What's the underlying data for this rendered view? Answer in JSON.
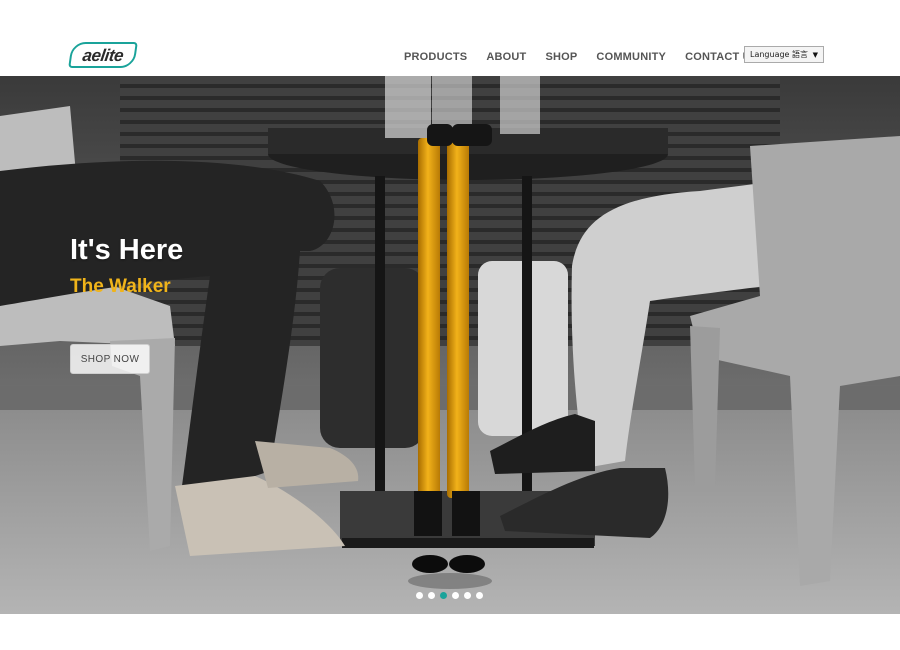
{
  "brand": {
    "logo_text": "aelite",
    "accent": "#1aa39a"
  },
  "nav": {
    "items": [
      {
        "label": "PRODUCTS"
      },
      {
        "label": "ABOUT"
      },
      {
        "label": "SHOP"
      },
      {
        "label": "COMMUNITY"
      },
      {
        "label": "CONTACT US"
      }
    ]
  },
  "language": {
    "selected": "Language 語言",
    "arrow_icon": "caret-down-icon"
  },
  "hero": {
    "title": "It's Here",
    "subtitle": "The Walker",
    "subtitle_color": "#f0b41a",
    "cta_label": "SHOP NOW",
    "image": "grayscale photo of two people seated at a cafe table with a folded yellow walking cane"
  },
  "carousel": {
    "slide_count": 6,
    "active_index": 2
  }
}
